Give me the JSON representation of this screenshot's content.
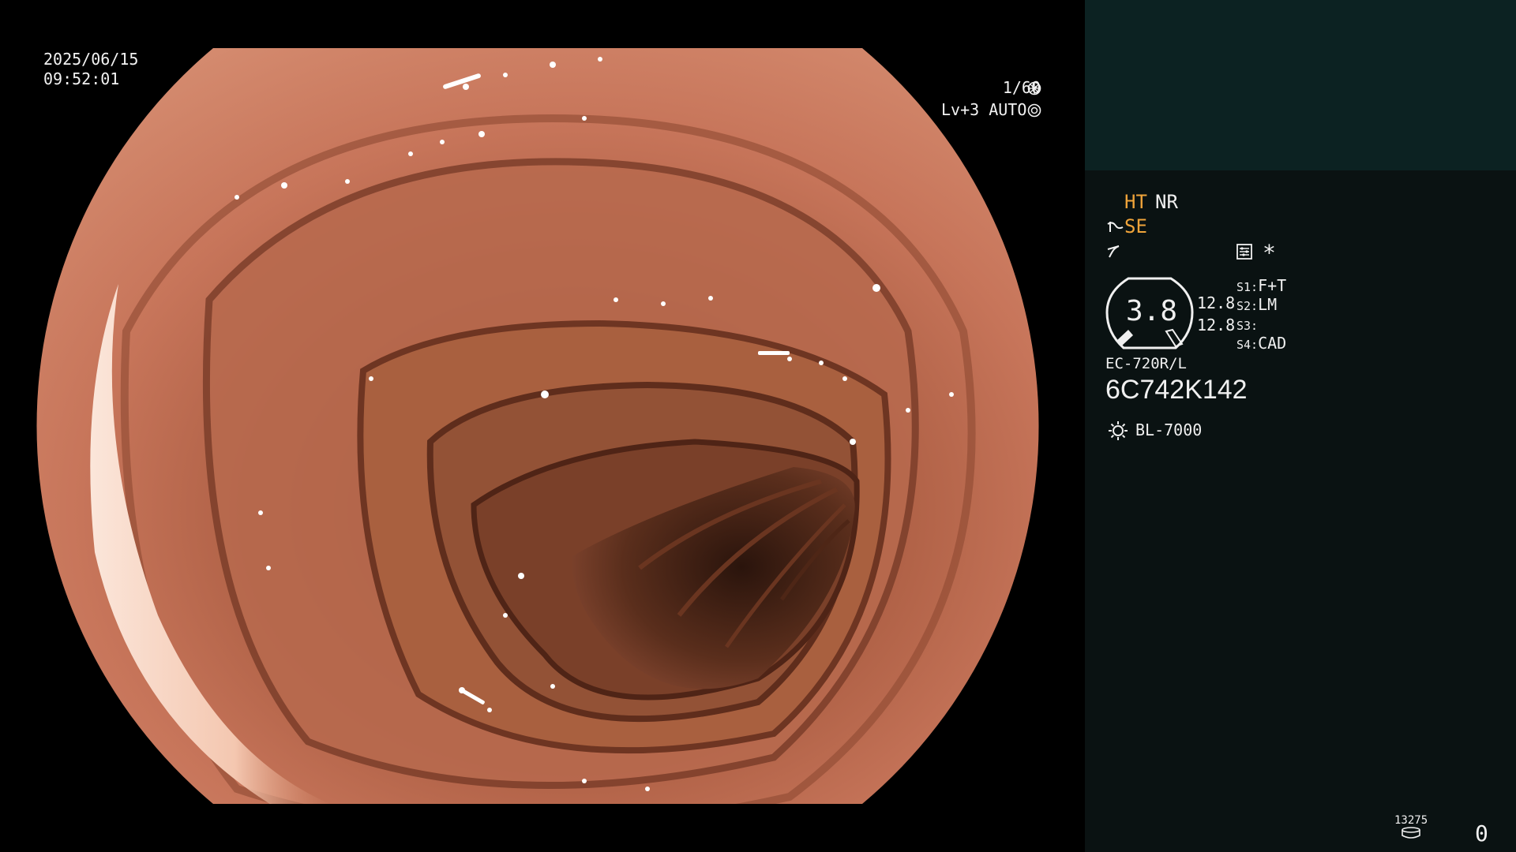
{
  "screen": {
    "date": "2025/06/15",
    "time": "09:52:01",
    "shutter": "1/60",
    "shutter_icon": "aperture-icon",
    "level": "Lv+3 AUTO",
    "level_icon": "iris-icon"
  },
  "panel": {
    "modes": {
      "ht": "HT",
      "nr": "NR",
      "se": "SE"
    },
    "ht_color": "#f0a43a",
    "se_color": "#f0a43a",
    "icons": [
      "scope-curve-icon",
      "zigzag-icon",
      "settings-card-icon",
      "star-icon"
    ],
    "star": "*",
    "gauge": {
      "value": "3.8",
      "top": "12.8",
      "bottom": "12.8"
    },
    "slots": [
      {
        "id": "S1:",
        "value": "F+T"
      },
      {
        "id": "S2:",
        "value": "LM"
      },
      {
        "id": "S3:",
        "value": ""
      },
      {
        "id": "S4:",
        "value": "CAD"
      }
    ],
    "scope_model": "EC-720R/L",
    "serial": "6C742K142",
    "light_source": "BL-7000",
    "light_icon": "light-source-icon",
    "counter": "13275",
    "counter_icon": "storage-icon",
    "count": "0"
  }
}
